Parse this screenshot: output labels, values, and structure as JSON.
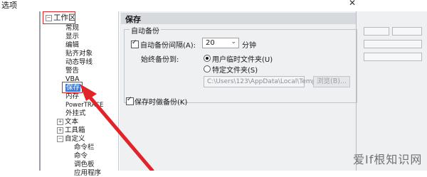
{
  "window": {
    "title": "选项",
    "close_glyph": "✕"
  },
  "tree": {
    "items": [
      {
        "label": "工作区",
        "expander": "−",
        "indent": 0
      },
      {
        "label": "常规",
        "indent": 1
      },
      {
        "label": "显示",
        "indent": 1
      },
      {
        "label": "编辑",
        "indent": 1
      },
      {
        "label": "贴齐对象",
        "indent": 1
      },
      {
        "label": "动态导线",
        "indent": 1
      },
      {
        "label": "警告",
        "indent": 1
      },
      {
        "label": "VBA",
        "indent": 1
      },
      {
        "label": "保存",
        "indent": 1,
        "selected": true
      },
      {
        "label": "内存",
        "indent": 1
      },
      {
        "label": "PowerTRACE",
        "indent": 1
      },
      {
        "label": "外挂式",
        "indent": 1
      },
      {
        "label": "文本",
        "expander": "+",
        "indent": 1
      },
      {
        "label": "工具箱",
        "expander": "+",
        "indent": 1
      },
      {
        "label": "自定义",
        "expander": "−",
        "indent": 1
      },
      {
        "label": "命令栏",
        "indent": 2
      },
      {
        "label": "命令",
        "indent": 2
      },
      {
        "label": "调色板",
        "indent": 2
      },
      {
        "label": "应用程序",
        "indent": 2
      }
    ]
  },
  "panel": {
    "title": "保存",
    "auto_backup": {
      "group_label": "自动备份",
      "interval_checkbox_label": "自动备份间隔(A):",
      "interval_checked": true,
      "interval_value": "20",
      "interval_unit": "分钟",
      "always_backup_to": "始终备份到:",
      "radio_user_temp": "用户临时文件夹(U)",
      "radio_specific": "特定文件夹(S)",
      "selected_radio": "user_temp",
      "path_value": "C:\\Users\\123\\AppData\\Local\\Temp\\",
      "browse_label": "浏览(B)..."
    },
    "save_backup_checkbox_label": "保存时做备份(K)",
    "save_backup_checked": true
  },
  "watermark": "爱If根知识网",
  "colors": {
    "highlight_red": "#e0242a",
    "selection_blue": "#3a7bd5"
  }
}
